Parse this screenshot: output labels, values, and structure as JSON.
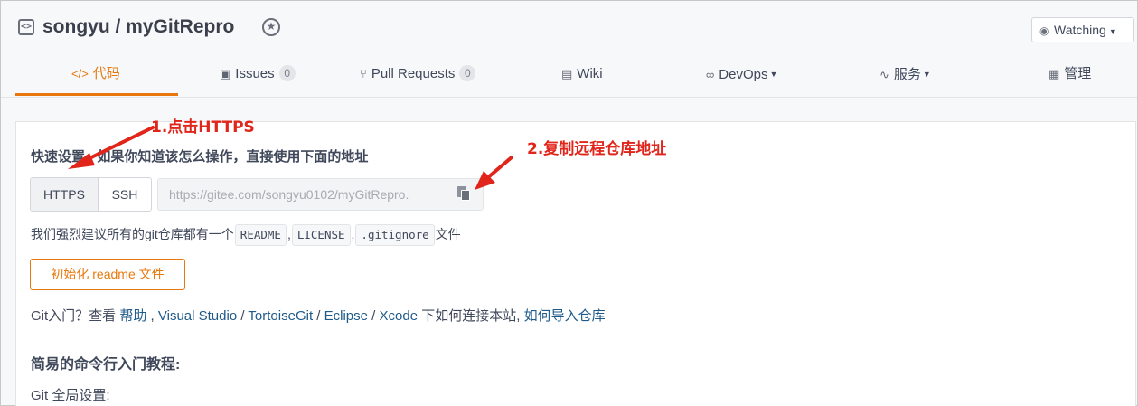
{
  "repo": {
    "title": "songyu / myGitRepro",
    "icon": "code-bracket-icon",
    "star_icon": "star-badge-icon"
  },
  "watch": {
    "label": "Watching",
    "icon": "eye-icon"
  },
  "tabs": [
    {
      "label": "代码",
      "icon": "code-icon",
      "active": true
    },
    {
      "label": "Issues",
      "icon": "issue-icon",
      "count": "0"
    },
    {
      "label": "Pull Requests",
      "icon": "pull-request-icon",
      "count": "0"
    },
    {
      "label": "Wiki",
      "icon": "book-icon"
    },
    {
      "label": "DevOps",
      "icon": "infinity-icon"
    },
    {
      "label": "服务",
      "icon": "pulse-icon"
    },
    {
      "label": "管理",
      "icon": "settings-doc-icon"
    }
  ],
  "quick_setup": {
    "title": "快速设置 - 如果你知道该怎么操作，直接使用下面的地址",
    "https_label": "HTTPS",
    "ssh_label": "SSH",
    "url": "https://gitee.com/songyu0102/myGitRepro.",
    "recommend_prefix": "我们强烈建议所有的git仓库都有一个",
    "readme": "README",
    "license": "LICENSE",
    "gitignore": ".gitignore",
    "sep": ",",
    "recommend_suffix": "文件",
    "init_button": "初始化 readme 文件"
  },
  "git_help": {
    "prefix": "Git入门？查看",
    "help": "帮助",
    "comma": ",",
    "links": [
      "Visual Studio",
      "TortoiseGit",
      "Eclipse",
      "Xcode"
    ],
    "slash": "/",
    "suffix": "下如何连接本站,",
    "import": "如何导入仓库"
  },
  "commands": {
    "title": "简易的命令行入门教程:",
    "global": "Git 全局设置:"
  },
  "annotations": {
    "step1": "1.点击HTTPS",
    "step2": "2.复制远程仓库地址",
    "color": "#e1251b"
  },
  "colors": {
    "accent": "#e8780e",
    "link": "#1e5a8a"
  }
}
